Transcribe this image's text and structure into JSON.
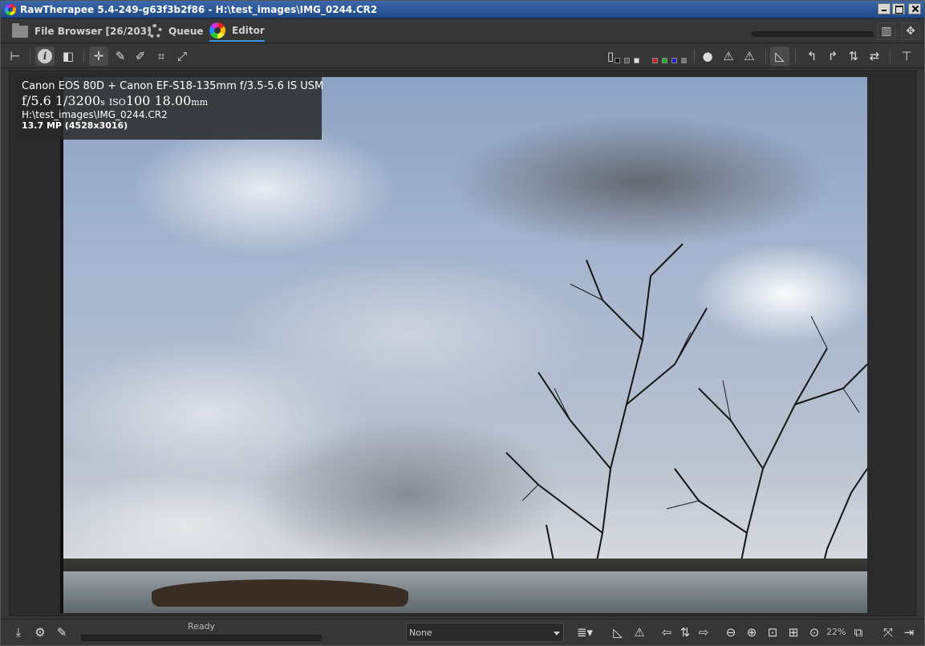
{
  "window": {
    "title": "RawTherapee 5.4-249-g63f3b2f86 - H:\\test_images\\IMG_0244.CR2"
  },
  "tabs": [
    {
      "label": "File Browser [26/203]",
      "icon": "folder-icon"
    },
    {
      "label": "Queue",
      "icon": "gears-icon"
    },
    {
      "label": "Editor",
      "icon": "color-wheel-icon",
      "active": true
    }
  ],
  "image_info": {
    "camera": "Canon EOS 80D + Canon EF-S18-135mm f/3.5-5.6 IS USM",
    "aperture": "f/5.6",
    "shutter": "1/3200",
    "shutter_unit": "s",
    "iso_prefix": "ISO",
    "iso": "100",
    "focal": "18.00",
    "focal_unit": "mm",
    "path": "H:\\test_images\\IMG_0244.CR2",
    "resolution": "13.7 MP (4528x3016)"
  },
  "status": {
    "text": "Ready",
    "profile_select": "None",
    "zoom": "22%"
  },
  "colors": {
    "accent": "#3d8fd9",
    "background": "#333333",
    "titlebar": "#2a57a0"
  }
}
